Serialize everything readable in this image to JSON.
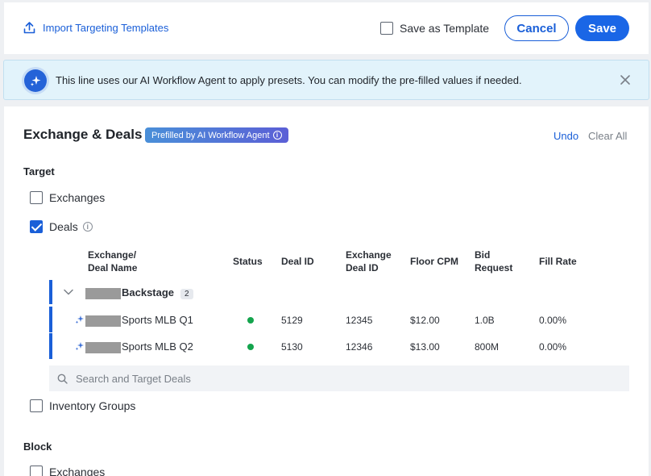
{
  "toolbar": {
    "import_label": "Import Targeting Templates",
    "save_as_template_label": "Save as Template",
    "cancel_label": "Cancel",
    "save_label": "Save"
  },
  "banner": {
    "text": "This line uses our AI Workflow Agent to apply presets. You can modify the pre-filled values if needed."
  },
  "section": {
    "title": "Exchange & Deals",
    "ai_pill": "Prefilled by AI Workflow Agent",
    "undo": "Undo",
    "clear_all": "Clear All"
  },
  "target": {
    "heading": "Target",
    "exchanges_label": "Exchanges",
    "exchanges_checked": false,
    "deals_label": "Deals",
    "deals_checked": true,
    "inventory_groups_label": "Inventory Groups",
    "inventory_groups_checked": false
  },
  "table": {
    "columns": {
      "name_1": "Exchange/",
      "name_2": "Deal Name",
      "status": "Status",
      "deal_id": "Deal ID",
      "exch_1": "Exchange",
      "exch_2": "Deal ID",
      "floor": "Floor CPM",
      "bid_1": "Bid",
      "bid_2": "Request",
      "fill": "Fill Rate"
    },
    "group": {
      "name": "Backstage",
      "count": "2"
    },
    "rows": [
      {
        "name": "Sports MLB Q1",
        "deal_id": "5129",
        "exchange_deal_id": "12345",
        "floor_cpm": "$12.00",
        "bid_request": "1.0B",
        "fill_rate": "0.00%"
      },
      {
        "name": "Sports MLB Q2",
        "deal_id": "5130",
        "exchange_deal_id": "12346",
        "floor_cpm": "$13.00",
        "bid_request": "800M",
        "fill_rate": "0.00%"
      }
    ],
    "search_placeholder": "Search and Target Deals"
  },
  "block": {
    "heading": "Block",
    "exchanges_label": "Exchanges"
  },
  "colors": {
    "accent": "#1a5fd8",
    "status_active": "#14a44d",
    "banner_bg": "#e2f3fb"
  }
}
